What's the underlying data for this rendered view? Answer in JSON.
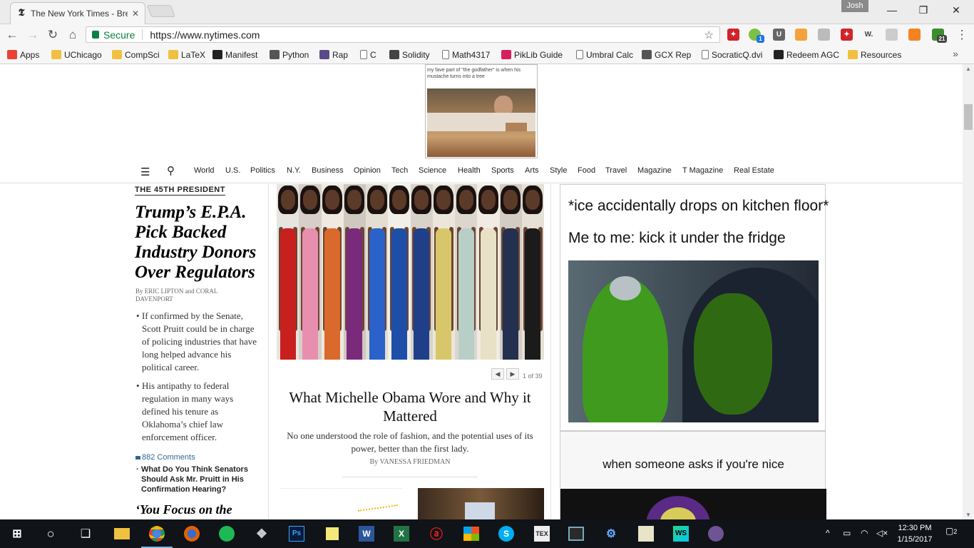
{
  "browser": {
    "tab_title": "The New York Times - Bre",
    "user_name": "Josh",
    "secure_label": "Secure",
    "url": "https://www.nytimes.com",
    "bookmarks": [
      {
        "label": "Apps",
        "icon": "apps-grid-icon"
      },
      {
        "label": "UChicago",
        "icon": "folder-icon"
      },
      {
        "label": "CompSci",
        "icon": "folder-icon"
      },
      {
        "label": "LaTeX",
        "icon": "folder-icon"
      },
      {
        "label": "Manifest",
        "icon": "github-icon"
      },
      {
        "label": "Python",
        "icon": "usb-icon"
      },
      {
        "label": "Rap",
        "icon": "rp-icon"
      },
      {
        "label": "C",
        "icon": "page-icon"
      },
      {
        "label": "Solidity",
        "icon": "solidity-icon"
      },
      {
        "label": "Math4317",
        "icon": "page-icon"
      },
      {
        "label": "PikLib Guide",
        "icon": "piklib-icon"
      },
      {
        "label": "Umbral Calc",
        "icon": "page-icon"
      },
      {
        "label": "GCX Rep",
        "icon": "reddit-icon"
      },
      {
        "label": "SocraticQ.dvi",
        "icon": "page-icon"
      },
      {
        "label": "Redeem AGC",
        "icon": "amazon-icon"
      },
      {
        "label": "Resources",
        "icon": "folder-icon"
      }
    ],
    "extension_badges": {
      "messages": "1",
      "counter": "21"
    }
  },
  "ad": {
    "caption": "my fave part of \"the godfather\" is when his mustache turns into a tree"
  },
  "nav": {
    "sections": [
      "World",
      "U.S.",
      "Politics",
      "N.Y.",
      "Business",
      "Opinion",
      "Tech",
      "Science",
      "Health",
      "Sports",
      "Arts",
      "Style",
      "Food",
      "Travel",
      "Magazine",
      "T Magazine",
      "Real Estate"
    ]
  },
  "left_column": {
    "kicker": "THE 45TH PRESIDENT",
    "headline": "Trump’s E.P.A. Pick Backed Industry Donors Over Regulators",
    "byline": "By ERIC LIPTON and CORAL DAVENPORT",
    "bullets": [
      "If confirmed by the Senate, Scott Pruitt could be in charge of policing industries that have long helped advance his political career.",
      "His antipathy to federal regulation in many ways defined his tenure as Oklahoma’s chief law enforcement officer."
    ],
    "comments": "882 Comments",
    "related": "What Do You Think Senators Should Ask Mr. Pruitt in His Confirmation Hearing?",
    "next_headline": "‘You Focus on the"
  },
  "center_column": {
    "gallery_count": "1 of 39",
    "gallery_dresses": [
      "#c8201e",
      "#e88fb0",
      "#d96a2c",
      "#7a2a7a",
      "#2a62c9",
      "#1e4fa8",
      "#1f3f8a",
      "#d8c76a",
      "#b8cfc8",
      "#e9e0c8",
      "#24304f",
      "#1b1b1b"
    ],
    "title": "What Michelle Obama Wore and Why it Mattered",
    "summary": "No one understood the role of fashion, and the potential uses of its power, better than the first lady.",
    "byline": "By VANESSA FRIEDMAN"
  },
  "right_column": {
    "meme1_line1": "*ice accidentally drops on kitchen floor*",
    "meme1_line2": "Me to me: kick it under the fridge",
    "meme2_text": "when someone asks if you're nice"
  },
  "taskbar": {
    "time": "12:30 PM",
    "date": "1/15/2017",
    "notifications": "2"
  }
}
